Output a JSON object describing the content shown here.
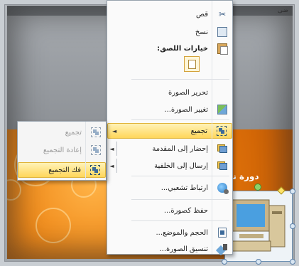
{
  "slide": {
    "top_right_text": "ضى",
    "title_fragment": "دورة نص"
  },
  "context_menu": {
    "items": [
      {
        "label": "قص",
        "icon": "scissors-icon"
      },
      {
        "label": "نسخ",
        "icon": "copy-icon"
      },
      {
        "label": "خيارات اللصق:",
        "icon": "paste-icon"
      },
      {
        "label": "تحرير الصورة",
        "icon": ""
      },
      {
        "label": "تغيير الصورة...",
        "icon": "change-picture-icon"
      },
      {
        "label": "تجميع",
        "icon": "group-icon"
      },
      {
        "label": "إحضار إلى المقدمة",
        "icon": "bring-to-front-icon"
      },
      {
        "label": "إرسال إلى الخلفية",
        "icon": "send-to-back-icon"
      },
      {
        "label": "ارتباط تشعبي...",
        "icon": "hyperlink-icon"
      },
      {
        "label": "حفظ كصورة...",
        "icon": ""
      },
      {
        "label": "الحجم والموضع...",
        "icon": "size-position-icon"
      },
      {
        "label": "تنسيق الصورة...",
        "icon": "format-picture-icon"
      }
    ]
  },
  "submenu": {
    "items": [
      {
        "label": "تجميع",
        "state": "disabled",
        "icon": "group-icon"
      },
      {
        "label": "إعادة التجميع",
        "state": "disabled",
        "icon": "regroup-icon"
      },
      {
        "label": "فك التجميع",
        "state": "highlighted",
        "icon": "ungroup-icon"
      }
    ]
  },
  "colors": {
    "highlight": "#ffd65a",
    "slide_orange": "#f08a1a"
  }
}
